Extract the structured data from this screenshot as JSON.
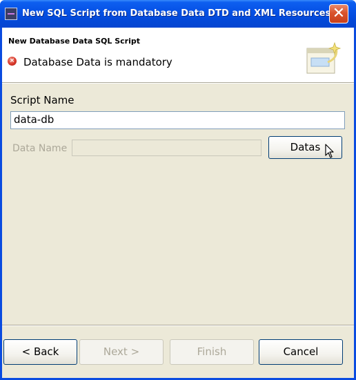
{
  "window": {
    "title": "New SQL Script from Database Data DTD and XML Resources",
    "close_glyph": "✕"
  },
  "header": {
    "title": "New Database Data SQL Script",
    "error_message": "Database Data is mandatory",
    "error_glyph": "×"
  },
  "form": {
    "script_name_label": "Script Name",
    "script_name_value": "data-db",
    "data_name_label": "Data Name",
    "data_name_value": "",
    "datas_button_label": "Datas"
  },
  "buttons": {
    "back": "< Back",
    "next": "Next >",
    "finish": "Finish",
    "cancel": "Cancel"
  },
  "colors": {
    "titlebar_blue": "#0652e6",
    "dialog_background": "#ece9d8",
    "close_button_red": "#d9532c",
    "error_red": "#d8372a"
  },
  "icons": {
    "app": "app-window-icon",
    "close": "close-icon",
    "error": "error-icon",
    "banner": "wizard-banner-icon",
    "cursor": "mouse-pointer-icon"
  }
}
